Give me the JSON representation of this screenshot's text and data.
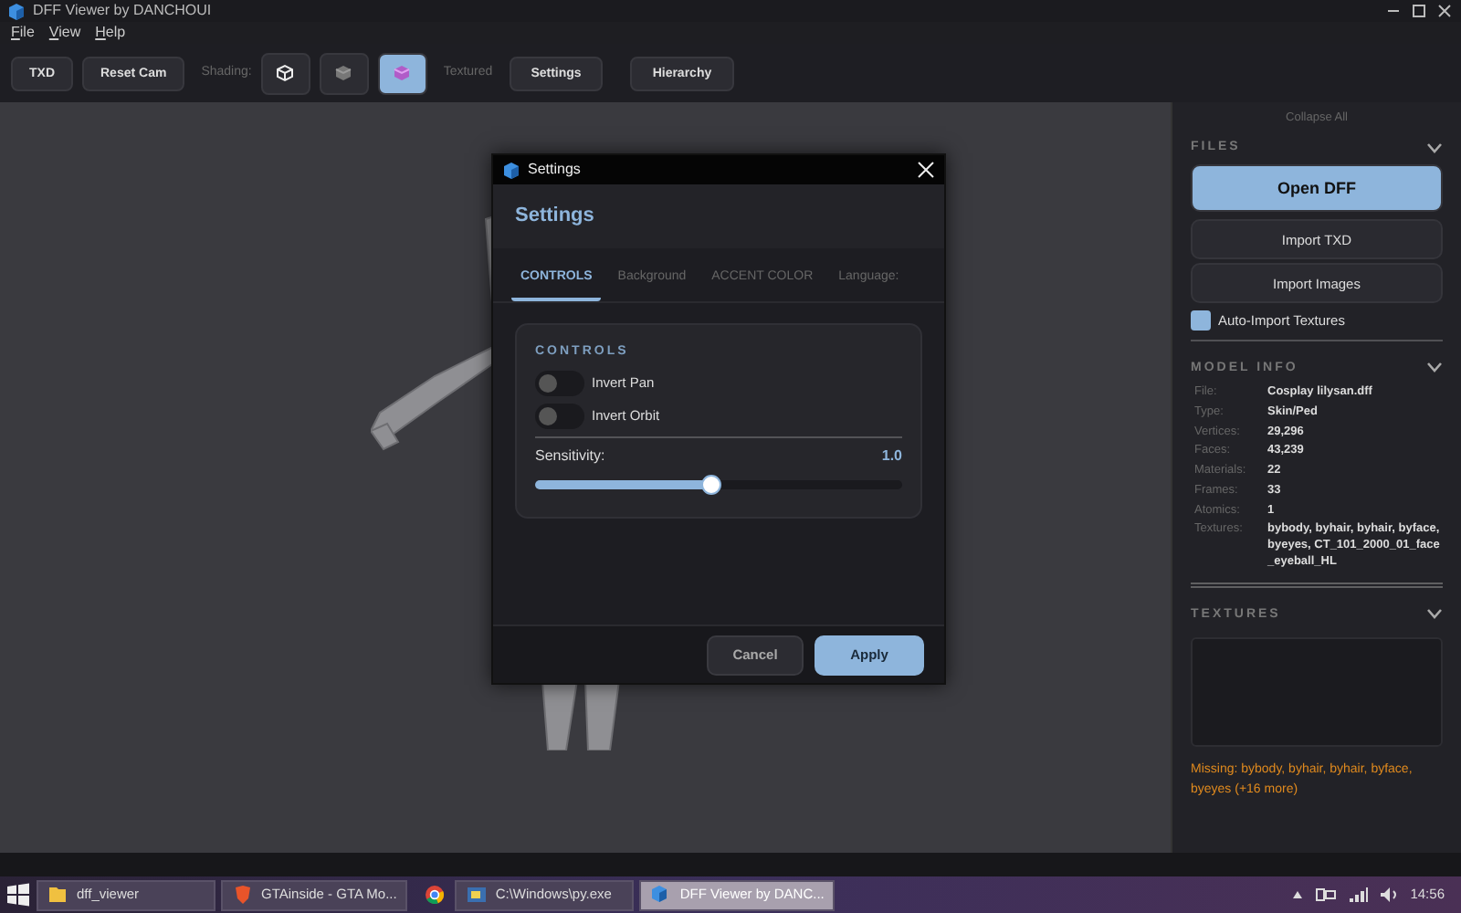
{
  "window": {
    "title": "DFF Viewer by DANCHOUI"
  },
  "menu": [
    "File",
    "View",
    "Help"
  ],
  "toolbar": {
    "buttons_left": [
      "TXD",
      "Reset Cam"
    ],
    "shading_label": "Shading:",
    "shading_modes": [
      {
        "kind": "wireframe",
        "selected": false
      },
      {
        "kind": "solid",
        "selected": false
      },
      {
        "kind": "textured",
        "selected": true
      }
    ],
    "mode_label": "Textured",
    "buttons_right": [
      "Settings",
      "Hierarchy"
    ]
  },
  "dialog": {
    "title": "Settings",
    "heading": "Settings",
    "tabs": [
      {
        "label": "CONTROLS",
        "selected": true
      },
      {
        "label": "Background",
        "selected": false
      },
      {
        "label": "ACCENT COLOR",
        "selected": false
      },
      {
        "label": "Language:",
        "selected": false
      }
    ],
    "section_title": "CONTROLS",
    "toggles": [
      {
        "label": "Invert Pan",
        "on": false
      },
      {
        "label": "Invert Orbit",
        "on": false
      }
    ],
    "slider": {
      "label": "Sensitivity:",
      "reading": "1.0",
      "level": 0.48
    },
    "buttons": [
      {
        "label": "Cancel",
        "kind": "secondary"
      },
      {
        "label": "Apply",
        "kind": "primary"
      }
    ]
  },
  "sidebar": {
    "collapse_all": "Collapse All",
    "files": {
      "title": "FILES",
      "expanded": true,
      "buttons": [
        {
          "label": "Open DFF",
          "kind": "primary"
        },
        {
          "label": "Import TXD",
          "kind": "secondary"
        },
        {
          "label": "Import Images",
          "kind": "secondary"
        }
      ],
      "checkbox": {
        "label": "Auto-Import Textures",
        "checked": true
      }
    },
    "model_info": {
      "title": "MODEL INFO",
      "expanded": true,
      "rows": [
        {
          "label": "File:",
          "value": "Cosplay lilysan.dff"
        },
        {
          "label": "Type:",
          "value": "Skin/Ped"
        },
        {
          "label": "Vertices:",
          "value": "29,296"
        },
        {
          "label": "Faces:",
          "value": "43,239"
        },
        {
          "label": "Materials:",
          "value": "22"
        },
        {
          "label": "Frames:",
          "value": "33"
        },
        {
          "label": "Atomics:",
          "value": "1"
        },
        {
          "label": "Textures:",
          "value": "bybody, byhair, byhair, byface, byeyes, CT_101_2000_01_face_eyeball_HL"
        }
      ]
    },
    "textures": {
      "title": "TEXTURES",
      "expanded": true,
      "missing": "Missing: bybody, byhair, byhair, byface, byeyes (+16 more)"
    }
  },
  "taskbar": {
    "items": [
      {
        "label": "dff_viewer",
        "kind": "folder",
        "selected": false
      },
      {
        "label": "GTAinside - GTA Mo...",
        "kind": "shield",
        "selected": false
      },
      {
        "kind": "browser",
        "selected": false
      },
      {
        "label": "C:\\Windows\\py.exe",
        "kind": "console",
        "selected": false
      },
      {
        "label": "DFF Viewer by DANC...",
        "kind": "app",
        "selected": true
      }
    ],
    "clock": "14:56"
  }
}
